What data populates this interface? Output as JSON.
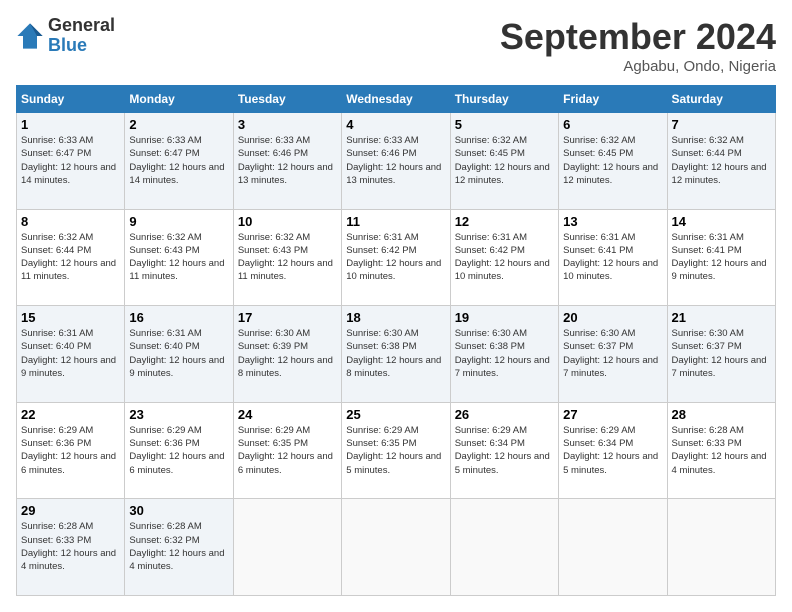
{
  "logo": {
    "general": "General",
    "blue": "Blue"
  },
  "title": "September 2024",
  "subtitle": "Agbabu, Ondo, Nigeria",
  "days_of_week": [
    "Sunday",
    "Monday",
    "Tuesday",
    "Wednesday",
    "Thursday",
    "Friday",
    "Saturday"
  ],
  "weeks": [
    [
      {
        "num": "1",
        "rise": "6:33 AM",
        "set": "6:47 PM",
        "daylight": "12 hours and 14 minutes."
      },
      {
        "num": "2",
        "rise": "6:33 AM",
        "set": "6:47 PM",
        "daylight": "12 hours and 14 minutes."
      },
      {
        "num": "3",
        "rise": "6:33 AM",
        "set": "6:46 PM",
        "daylight": "12 hours and 13 minutes."
      },
      {
        "num": "4",
        "rise": "6:33 AM",
        "set": "6:46 PM",
        "daylight": "12 hours and 13 minutes."
      },
      {
        "num": "5",
        "rise": "6:32 AM",
        "set": "6:45 PM",
        "daylight": "12 hours and 12 minutes."
      },
      {
        "num": "6",
        "rise": "6:32 AM",
        "set": "6:45 PM",
        "daylight": "12 hours and 12 minutes."
      },
      {
        "num": "7",
        "rise": "6:32 AM",
        "set": "6:44 PM",
        "daylight": "12 hours and 12 minutes."
      }
    ],
    [
      {
        "num": "8",
        "rise": "6:32 AM",
        "set": "6:44 PM",
        "daylight": "12 hours and 11 minutes."
      },
      {
        "num": "9",
        "rise": "6:32 AM",
        "set": "6:43 PM",
        "daylight": "12 hours and 11 minutes."
      },
      {
        "num": "10",
        "rise": "6:32 AM",
        "set": "6:43 PM",
        "daylight": "12 hours and 11 minutes."
      },
      {
        "num": "11",
        "rise": "6:31 AM",
        "set": "6:42 PM",
        "daylight": "12 hours and 10 minutes."
      },
      {
        "num": "12",
        "rise": "6:31 AM",
        "set": "6:42 PM",
        "daylight": "12 hours and 10 minutes."
      },
      {
        "num": "13",
        "rise": "6:31 AM",
        "set": "6:41 PM",
        "daylight": "12 hours and 10 minutes."
      },
      {
        "num": "14",
        "rise": "6:31 AM",
        "set": "6:41 PM",
        "daylight": "12 hours and 9 minutes."
      }
    ],
    [
      {
        "num": "15",
        "rise": "6:31 AM",
        "set": "6:40 PM",
        "daylight": "12 hours and 9 minutes."
      },
      {
        "num": "16",
        "rise": "6:31 AM",
        "set": "6:40 PM",
        "daylight": "12 hours and 9 minutes."
      },
      {
        "num": "17",
        "rise": "6:30 AM",
        "set": "6:39 PM",
        "daylight": "12 hours and 8 minutes."
      },
      {
        "num": "18",
        "rise": "6:30 AM",
        "set": "6:38 PM",
        "daylight": "12 hours and 8 minutes."
      },
      {
        "num": "19",
        "rise": "6:30 AM",
        "set": "6:38 PM",
        "daylight": "12 hours and 7 minutes."
      },
      {
        "num": "20",
        "rise": "6:30 AM",
        "set": "6:37 PM",
        "daylight": "12 hours and 7 minutes."
      },
      {
        "num": "21",
        "rise": "6:30 AM",
        "set": "6:37 PM",
        "daylight": "12 hours and 7 minutes."
      }
    ],
    [
      {
        "num": "22",
        "rise": "6:29 AM",
        "set": "6:36 PM",
        "daylight": "12 hours and 6 minutes."
      },
      {
        "num": "23",
        "rise": "6:29 AM",
        "set": "6:36 PM",
        "daylight": "12 hours and 6 minutes."
      },
      {
        "num": "24",
        "rise": "6:29 AM",
        "set": "6:35 PM",
        "daylight": "12 hours and 6 minutes."
      },
      {
        "num": "25",
        "rise": "6:29 AM",
        "set": "6:35 PM",
        "daylight": "12 hours and 5 minutes."
      },
      {
        "num": "26",
        "rise": "6:29 AM",
        "set": "6:34 PM",
        "daylight": "12 hours and 5 minutes."
      },
      {
        "num": "27",
        "rise": "6:29 AM",
        "set": "6:34 PM",
        "daylight": "12 hours and 5 minutes."
      },
      {
        "num": "28",
        "rise": "6:28 AM",
        "set": "6:33 PM",
        "daylight": "12 hours and 4 minutes."
      }
    ],
    [
      {
        "num": "29",
        "rise": "6:28 AM",
        "set": "6:33 PM",
        "daylight": "12 hours and 4 minutes."
      },
      {
        "num": "30",
        "rise": "6:28 AM",
        "set": "6:32 PM",
        "daylight": "12 hours and 4 minutes."
      },
      null,
      null,
      null,
      null,
      null
    ]
  ],
  "labels": {
    "sunrise": "Sunrise:",
    "sunset": "Sunset:",
    "daylight": "Daylight:"
  }
}
